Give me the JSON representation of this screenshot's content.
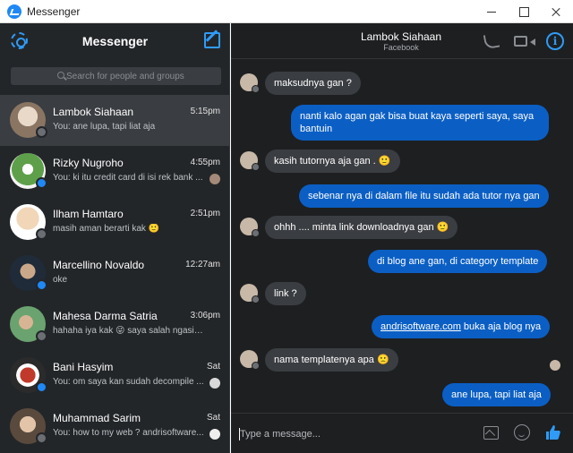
{
  "window": {
    "title": "Messenger"
  },
  "sidebar": {
    "title": "Messenger",
    "search_placeholder": "Search for people and groups",
    "conversations": [
      {
        "name": "Lambok Siahaan",
        "time": "5:15pm",
        "preview": "You: ane lupa, tapi liat aja",
        "avatar_color": "#c8b8a8",
        "badge": "fb",
        "active": true
      },
      {
        "name": "Rizky Nugroho",
        "time": "4:55pm",
        "preview": "You: ki itu credit card di isi rek bank ...",
        "avatar_color": "#5ea04a",
        "badge": "ms",
        "active": false
      },
      {
        "name": "Ilham Hamtaro",
        "time": "2:51pm",
        "preview": "masih aman berarti kak 🙂",
        "avatar_color": "#f2d6b8",
        "badge": "fb",
        "active": false
      },
      {
        "name": "Marcellino Novaldo",
        "time": "12:27am",
        "preview": "oke",
        "avatar_color": "#2c3e50",
        "badge": "ms",
        "active": false
      },
      {
        "name": "Mahesa Darma Satria",
        "time": "3:06pm",
        "preview": "hahaha iya kak 😜 saya salah ngasih tah...",
        "avatar_color": "#6aa36f",
        "badge": "fb",
        "active": false
      },
      {
        "name": "Bani Hasyim",
        "time": "Sat",
        "preview": "You: om saya kan sudah decompile ...",
        "avatar_color": "#c0392b",
        "badge": "ms",
        "active": false
      },
      {
        "name": "Muhammad Sarim",
        "time": "Sat",
        "preview": "You: how to my web ? andrisoftware...",
        "avatar_color": "#8d7f73",
        "badge": "fb",
        "active": false
      }
    ]
  },
  "chat": {
    "name": "Lambok Siahaan",
    "subtitle": "Facebook",
    "messages": [
      {
        "dir": "in",
        "text": "maksudnya gan ?"
      },
      {
        "dir": "out",
        "text": "nanti kalo agan gak bisa buat kaya seperti saya, saya bantuin"
      },
      {
        "dir": "in",
        "text": "kasih tutornya aja gan . 🙂"
      },
      {
        "dir": "out",
        "text": "sebenar nya di dalam file itu sudah ada tutor nya gan"
      },
      {
        "dir": "in",
        "text": "ohhh .... minta link downloadnya gan 🙂"
      },
      {
        "dir": "out",
        "text": "di blog ane gan, di category template"
      },
      {
        "dir": "in",
        "text": "link ?"
      },
      {
        "dir": "out",
        "link": "andrisoftware.com",
        "text": " buka aja blog nya"
      },
      {
        "dir": "in",
        "text": "nama templatenya apa 🙁"
      },
      {
        "dir": "out",
        "text": "ane lupa, tapi liat aja"
      }
    ],
    "composer_placeholder": "Type a message..."
  },
  "colors": {
    "accent": "#2f9bf7",
    "outgoing_bubble": "#0b5fc4",
    "incoming_bubble": "#3a3d41",
    "sidebar_bg": "#232629",
    "chat_bg": "#1e1f21"
  }
}
